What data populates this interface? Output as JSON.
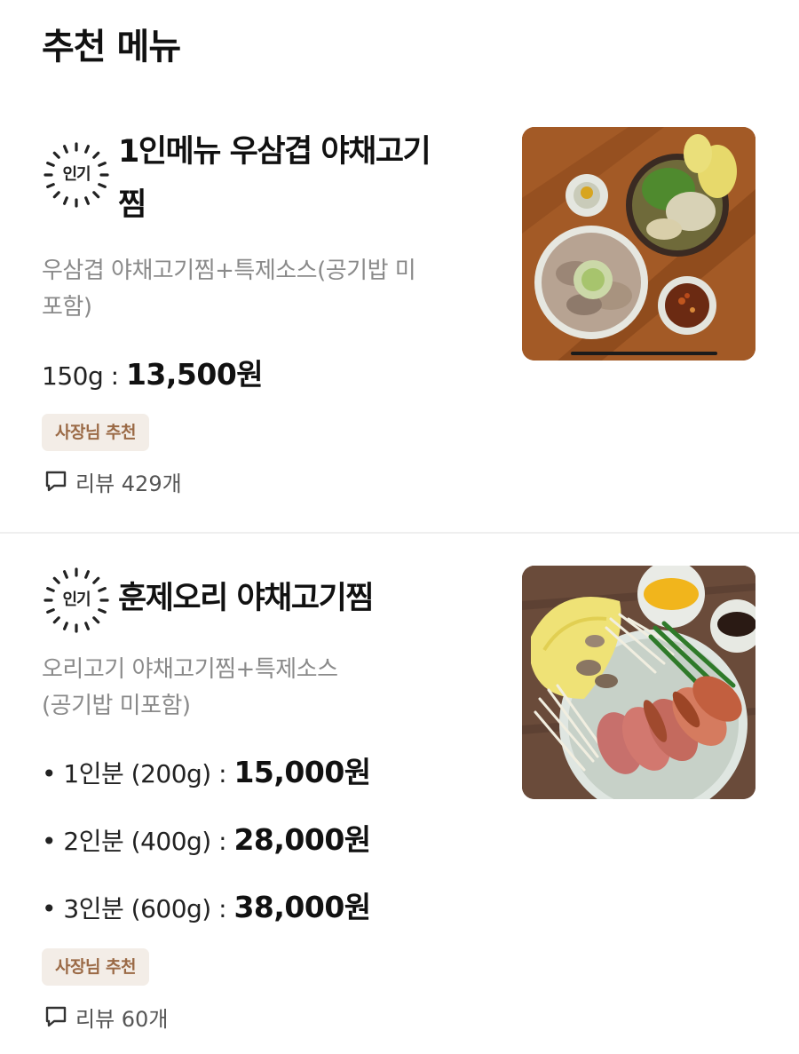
{
  "page": {
    "title": "추천 메뉴"
  },
  "menus": [
    {
      "badge": "인기",
      "name_line1": "1인메뉴 우삼겹 야채고기",
      "name_line2": "찜",
      "desc_line1": "우삼겹 야채고기찜+특제소스(공기밥 미",
      "desc_line2": "포함)",
      "prices": [
        {
          "label": "150g : ",
          "amount": "13,500원"
        }
      ],
      "tag": "사장님 추천",
      "review": "리뷰 429개",
      "image_icon": "beef-vegetable-steam-dish-photo"
    },
    {
      "badge": "인기",
      "name_line1": "훈제오리 야채고기찜",
      "desc_line1": "오리고기 야채고기찜+특제소스",
      "desc_line2": "(공기밥 미포함)",
      "prices": [
        {
          "label": "• 1인분 (200g) : ",
          "amount": "15,000원"
        },
        {
          "label": "• 2인분 (400g) : ",
          "amount": "28,000원"
        },
        {
          "label": "• 3인분 (600g) : ",
          "amount": "38,000원"
        }
      ],
      "tag": "사장님 추천",
      "review": "리뷰 60개",
      "image_icon": "smoked-duck-vegetable-dish-photo"
    }
  ],
  "colors": {
    "tag_bg": "#f3ede7",
    "tag_text": "#9b6a46",
    "desc_text": "#8a8a8a",
    "divider": "#efefef"
  }
}
